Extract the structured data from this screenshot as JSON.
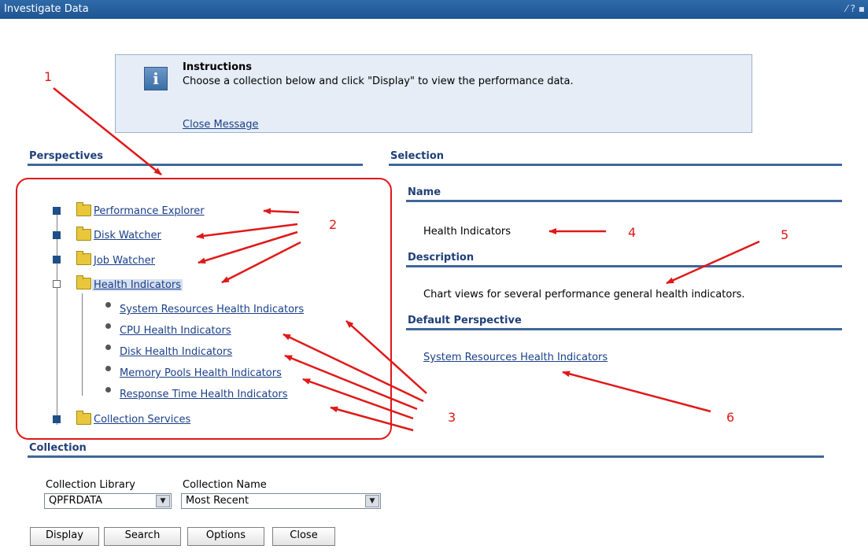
{
  "window": {
    "title": "Investigate Data",
    "tools": "⁄ ? ▪"
  },
  "instructions": {
    "title": "Instructions",
    "text": "Choose a collection below and click \"Display\" to view the performance data.",
    "close_link": "Close Message",
    "icon": "info-icon"
  },
  "perspectives": {
    "heading": "Perspectives",
    "items": [
      {
        "label": "Performance Explorer",
        "state": "collapsed"
      },
      {
        "label": "Disk Watcher",
        "state": "collapsed"
      },
      {
        "label": "Job Watcher",
        "state": "collapsed"
      },
      {
        "label": "Health Indicators",
        "state": "expanded",
        "selected": true,
        "children": [
          "System Resources Health Indicators",
          "CPU Health Indicators",
          "Disk Health Indicators",
          "Memory Pools Health Indicators",
          "Response Time Health Indicators"
        ]
      },
      {
        "label": "Collection Services",
        "state": "collapsed"
      }
    ]
  },
  "selection": {
    "heading": "Selection",
    "name_heading": "Name",
    "name_value": "Health Indicators",
    "description_heading": "Description",
    "description_value": "Chart views for several performance general health indicators.",
    "default_perspective_heading": "Default Perspective",
    "default_perspective_value": "System Resources Health Indicators"
  },
  "collection": {
    "heading": "Collection",
    "library_label": "Collection Library",
    "library_value": "QPFRDATA",
    "name_label": "Collection Name",
    "name_value": "Most Recent"
  },
  "buttons": {
    "display": "Display",
    "search": "Search",
    "options": "Options",
    "close": "Close"
  },
  "annotations": {
    "n1": "1",
    "n2": "2",
    "n3": "3",
    "n4": "4",
    "n5": "5",
    "n6": "6"
  },
  "colors": {
    "title_bar": "#1e5592",
    "annotation_red": "#e01818",
    "link": "#1a3f88",
    "rule": "#3f679a"
  }
}
